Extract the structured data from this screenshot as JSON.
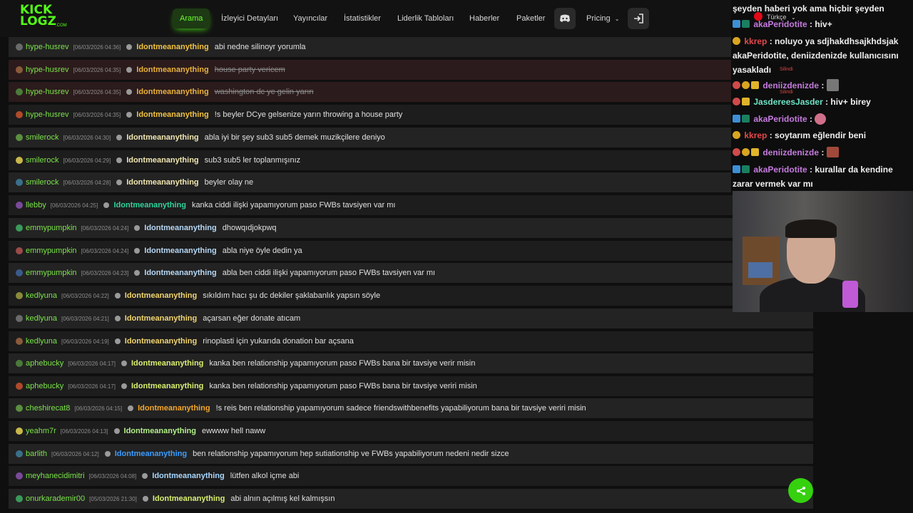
{
  "logo": {
    "line1": "KICK",
    "line2": "LOGZ",
    "suffix": ".COM"
  },
  "nav": [
    {
      "label": "Arama",
      "active": true
    },
    {
      "label": "İzleyici Detayları"
    },
    {
      "label": "Yayıncılar"
    },
    {
      "label": "İstatistikler"
    },
    {
      "label": "Liderlik Tabloları"
    },
    {
      "label": "Haberler"
    },
    {
      "label": "Paketler"
    },
    {
      "label": "Pricing"
    }
  ],
  "language": "Türkçe",
  "rows": [
    {
      "user": "hype-husrev",
      "time": "[06/03/2026 04:36]",
      "sender": "Idontmeananything",
      "text": "abi nedne silinoyr yorumla",
      "deleted": false
    },
    {
      "user": "hype-husrev",
      "time": "[06/03/2026 04:35]",
      "sender": "Idontmeananything",
      "text": "house party vericem",
      "deleted": true
    },
    {
      "user": "hype-husrev",
      "time": "[06/03/2026 04:35]",
      "sender": "Idontmeananything",
      "text": "washington dc ye gelin yarın",
      "deleted": true
    },
    {
      "user": "hype-husrev",
      "time": "[06/03/2026 04:35]",
      "sender": "Idontmeananything",
      "text": "!s beyler DCye gelsenize yarın throwing a house party",
      "deleted": false
    },
    {
      "user": "smilerock",
      "time": "[06/03/2026 04:30]",
      "sender": "Idontmeananything",
      "text": "abla iyi bir şey sub3 sub5 demek muzikçilere deniyo",
      "deleted": false
    },
    {
      "user": "smilerock",
      "time": "[06/03/2026 04:29]",
      "sender": "Idontmeananything",
      "text": "sub3 sub5 ler toplanmışınız",
      "deleted": false
    },
    {
      "user": "smilerock",
      "time": "[06/03/2026 04:28]",
      "sender": "Idontmeananything",
      "text": "beyler olay ne",
      "deleted": false
    },
    {
      "user": "llebby",
      "time": "[06/03/2026 04:25]",
      "sender": "Idontmeananything",
      "text": "kanka ciddi ilişki yapamıyorum paso FWBs tavsiyen var mı",
      "deleted": false
    },
    {
      "user": "emmypumpkin",
      "time": "[06/03/2026 04:24]",
      "sender": "Idontmeananything",
      "text": "dhowqıdjokpwq",
      "deleted": false
    },
    {
      "user": "emmypumpkin",
      "time": "[06/03/2026 04:24]",
      "sender": "Idontmeananything",
      "text": "abla niye öyle dedin ya",
      "deleted": false
    },
    {
      "user": "emmypumpkin",
      "time": "[06/03/2026 04:23]",
      "sender": "Idontmeananything",
      "text": "abla ben ciddi ilişki yapamıyorum paso FWBs tavsiyen var mı",
      "deleted": false
    },
    {
      "user": "kedlyuna",
      "time": "[06/03/2026 04:22]",
      "sender": "Idontmeananything",
      "text": "sıkıldım hacı şu dc dekiler şaklabanlık yapsın söyle",
      "deleted": false
    },
    {
      "user": "kedlyuna",
      "time": "[06/03/2026 04:21]",
      "sender": "Idontmeananything",
      "text": "açarsan eğer donate atıcam",
      "deleted": false
    },
    {
      "user": "kedlyuna",
      "time": "[06/03/2026 04:19]",
      "sender": "Idontmeananything",
      "text": "rinoplasti için yukarıda donation bar açsana",
      "deleted": false
    },
    {
      "user": "aphebucky",
      "time": "[06/03/2026 04:17]",
      "sender": "Idontmeananything",
      "text": "kanka ben relationship yapamıyorum paso FWBs bana bir tavsiye verir misin",
      "deleted": false
    },
    {
      "user": "aphebucky",
      "time": "[06/03/2026 04:17]",
      "sender": "Idontmeananything",
      "text": "kanka ben relationship yapamıyorum paso FWBs bana bir tavsiye veriri misin",
      "deleted": false
    },
    {
      "user": "cheshirecat8",
      "time": "[06/03/2026 04:15]",
      "sender": "Idontmeananything",
      "text": "!s reis ben relationship yapamıyorum sadece friendswithbenefits yapabiliyorum bana bir tavsiye veriri misin",
      "deleted": false
    },
    {
      "user": "yeahm7r",
      "time": "[06/03/2026 04:13]",
      "sender": "Idontmeananything",
      "text": "ewwww hell naww",
      "deleted": false
    },
    {
      "user": "barlith",
      "time": "[06/03/2026 04:12]",
      "sender": "Idontmeananything",
      "text": "ben relationship yapamıyorum hep sutiationship ve FWBs yapabiliyorum nedeni nedir sizce",
      "deleted": false
    },
    {
      "user": "meyhanecidimitri",
      "time": "[06/03/2026 04:08]",
      "sender": "Idontmeananything",
      "text": "lütfen alkol içme abi",
      "deleted": false
    },
    {
      "user": "onurkarademir00",
      "time": "[05/03/2026 21:30]",
      "sender": "Idontmeananything",
      "text": "abi alnın açılmış kel kalmışsın",
      "deleted": false
    }
  ],
  "colors": {
    "sender_colors": [
      "#f3c340",
      "#e8b23d",
      "#e8b23d",
      "#f3c340",
      "#f0e6b0",
      "#f0e6b0",
      "#f0e6b0",
      "#2fd39b",
      "#b6d7f5",
      "#b6d7f5",
      "#b6d7f5",
      "#f2d56f",
      "#f2d56f",
      "#f2d56f",
      "#d8f070",
      "#d8f070",
      "#f3a72a",
      "#b3f08a",
      "#3b9dff",
      "#a8d8ff",
      "#d8f070"
    ],
    "user_color": "#7be349"
  },
  "chat": {
    "lines": [
      {
        "user": "",
        "text": "şeyden haberi yok ama hiçbir şeyden"
      },
      {
        "user": "akaPeridotite",
        "text": " : hiv+"
      },
      {
        "user": "kkrep",
        "text": " : noluyo ya sdjhakdhsajkhdsjak akaPeridotite, deniizdenizde kullanıcısını yasakladı"
      },
      {
        "user": "deniizdenizde",
        "text": " :"
      },
      {
        "user": "JasdereesJasder",
        "text": " : hiv+ birey"
      },
      {
        "user": "akaPeridotite",
        "text": " :"
      },
      {
        "user": "kkrep",
        "text": " : soytarım eğlendir beni"
      },
      {
        "user": "deniizdenizde",
        "text": " :"
      },
      {
        "user": "akaPeridotite",
        "text": " : kurallar da kendine zarar vermek var mı"
      }
    ],
    "deleted_label": "Silindi"
  }
}
